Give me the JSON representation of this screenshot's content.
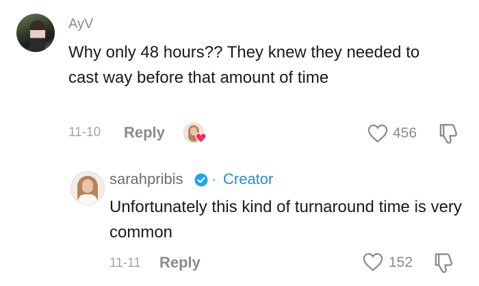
{
  "comment": {
    "username": "AyV",
    "text": "Why only 48 hours?? They knew they needed to cast way before that amount of time",
    "date": "11-10",
    "reply_label": "Reply",
    "like_count": "456",
    "creator_liked": true
  },
  "reply": {
    "username": "sarahpribis",
    "verified": true,
    "separator": "·",
    "badge": "Creator",
    "text": "Unfortunately this kind of turnaround time is very common",
    "date": "11-11",
    "reply_label": "Reply",
    "like_count": "152"
  },
  "icons": {
    "like": "heart-outline-icon",
    "dislike": "thumbs-down-icon",
    "verified": "verified-check-icon",
    "creator_liked": "heart-filled-icon"
  },
  "colors": {
    "verified_blue": "#20a6e8",
    "creator_blue": "#2a8bd0",
    "heart_red": "#fe2c55",
    "text_primary": "#161823",
    "text_secondary": "#8a8b91"
  }
}
